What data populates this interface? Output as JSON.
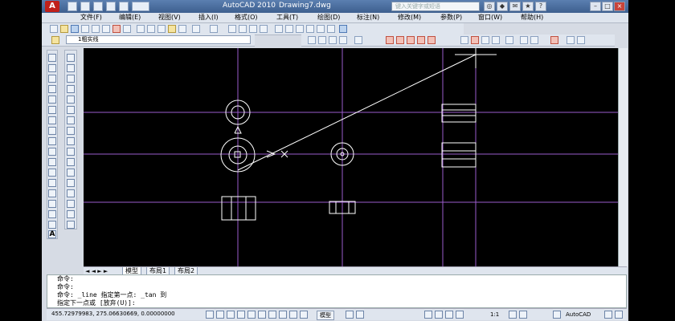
{
  "window": {
    "app_title": "AutoCAD 2010",
    "doc_title": "Drawing7.dwg",
    "search_placeholder": "键入关键字或短语",
    "logo": "A"
  },
  "menu": [
    "文件(F)",
    "编辑(E)",
    "视图(V)",
    "插入(I)",
    "格式(O)",
    "工具(T)",
    "绘图(D)",
    "标注(N)",
    "修改(M)",
    "参数(P)",
    "窗口(W)",
    "帮助(H)"
  ],
  "layer_toolbar": {
    "layer_value": "1粗实线"
  },
  "layout_tabs": [
    "模型",
    "布局1",
    "布局2"
  ],
  "command_lines": [
    "命令:",
    "命令:",
    "命令: _line 指定第一点: _tan 到",
    "指定下一点或 [放弃(U)]:"
  ],
  "status": {
    "coords": "455.72979983, 275.06630669, 0.00000000",
    "model_label": "模型",
    "scale_label": "1:1",
    "workspace_label": "AutoCAD"
  },
  "colors": {
    "canvas": "#000000",
    "centerline": "#a060d0",
    "geometry": "#ffffff"
  }
}
